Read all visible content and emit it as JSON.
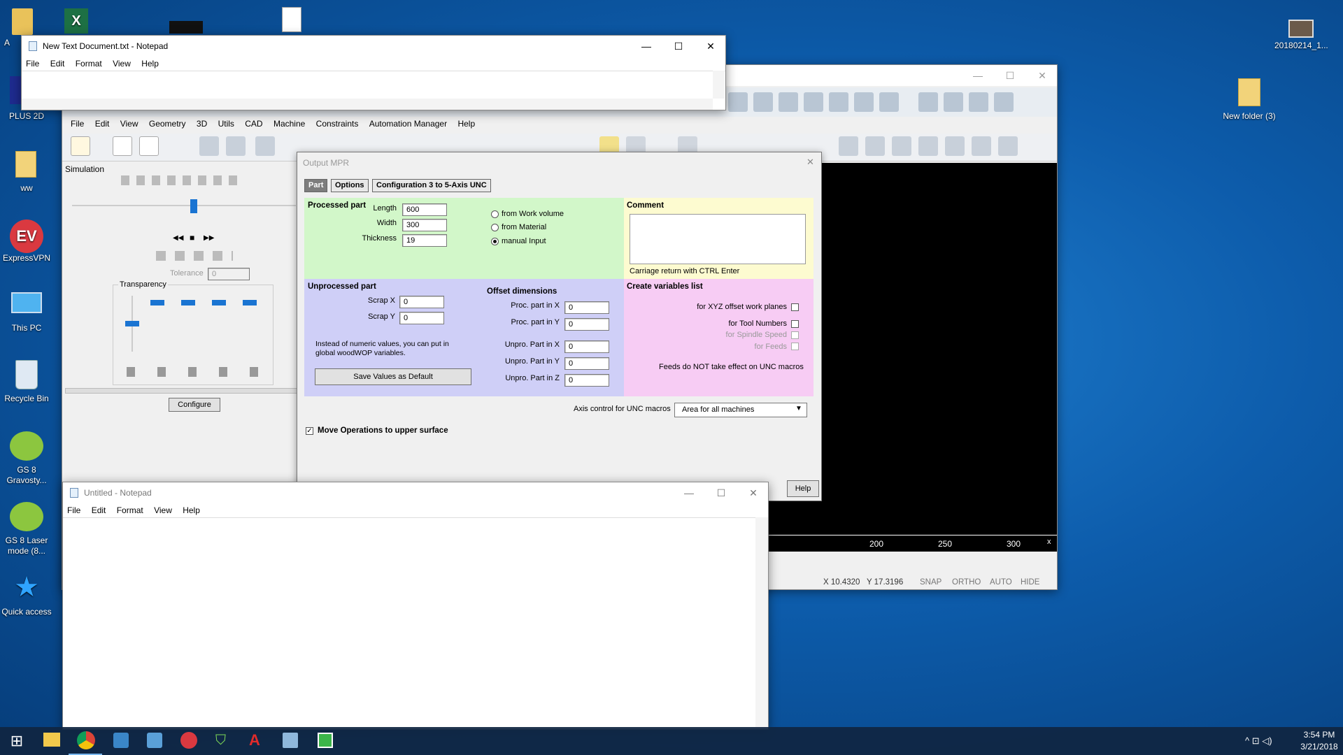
{
  "desktop": {
    "icons": [
      {
        "label": "A"
      },
      {
        "label": "PLUS 2D"
      },
      {
        "label": "ww"
      },
      {
        "label": "ExpressVPN"
      },
      {
        "label": "This PC"
      },
      {
        "label": "Recycle Bin"
      },
      {
        "label": "GS 8 Gravosty..."
      },
      {
        "label": "GS 8 Laser mode (8..."
      },
      {
        "label": "Quick access"
      },
      {
        "label": "20180214_1..."
      },
      {
        "label": "New folder (3)"
      }
    ]
  },
  "notepad_top": {
    "title": "New Text Document.txt - Notepad",
    "menu": [
      "File",
      "Edit",
      "Format",
      "View",
      "Help"
    ],
    "min": "—",
    "max": "☐",
    "close": "✕"
  },
  "cad": {
    "menu": [
      "File",
      "Edit",
      "View",
      "Geometry",
      "3D",
      "Utils",
      "CAD",
      "Machine",
      "Constraints",
      "Automation Manager",
      "Help"
    ],
    "min": "—",
    "max": "☐",
    "close": "✕",
    "simulation": {
      "title": "Simulation",
      "tolerance_label": "Tolerance",
      "tolerance_value": "0",
      "transparency": "Transparency",
      "configure": "Configure"
    },
    "ruler": [
      "200",
      "250",
      "300"
    ],
    "ruler_x": "x",
    "status": [
      "X 10.4320",
      "Y 17.3196",
      "SNAP",
      "ORTHO",
      "AUTO",
      "HIDE"
    ]
  },
  "dialog": {
    "title": "Output MPR",
    "close": "✕",
    "tabs": [
      "Part",
      "Options",
      "Configuration 3 to 5-Axis UNC"
    ],
    "processed": {
      "title": "Processed part",
      "length_label": "Length",
      "length": "600",
      "width_label": "Width",
      "width": "300",
      "thickness_label": "Thickness",
      "thickness": "19"
    },
    "source": [
      "from Work volume",
      "from Material",
      "manual Input"
    ],
    "comment": {
      "title": "Comment",
      "hint": "Carriage return with CTRL Enter"
    },
    "unprocessed": {
      "title": "Unprocessed part",
      "scrapx_label": "Scrap X",
      "scrapx": "0",
      "scrapy_label": "Scrap Y",
      "scrapy": "0",
      "info": "Instead of numeric values, you can put in global woodWOP variables.",
      "save": "Save Values as Default"
    },
    "offset": {
      "title": "Offset dimensions",
      "rows": [
        {
          "label": "Proc. part in X",
          "value": "0"
        },
        {
          "label": "Proc. part in Y",
          "value": "0"
        },
        {
          "label": "Unpro. Part in X",
          "value": "0"
        },
        {
          "label": "Unpro. Part in Y",
          "value": "0"
        },
        {
          "label": "Unpro. Part in Z",
          "value": "0"
        }
      ]
    },
    "vars": {
      "title": "Create variables list",
      "items": [
        "for XYZ offset work planes",
        "for Tool Numbers",
        "for Spindle Speed",
        "for Feeds"
      ],
      "note": "Feeds do NOT take effect on UNC macros"
    },
    "axis": {
      "label": "Axis control for UNC macros",
      "value": "Area for all machines"
    },
    "move_ops": "Move Operations to upper surface",
    "help": "Help"
  },
  "notepad_bottom": {
    "title": "Untitled - Notepad",
    "menu": [
      "File",
      "Edit",
      "Format",
      "View",
      "Help"
    ],
    "min": "—",
    "max": "☐",
    "close": "✕"
  },
  "taskbar": {
    "time": "3:54 PM",
    "date": "3/21/2018",
    "tray": "^ ⊡ ◁)"
  },
  "colors": {
    "processed": "#d2f7c9",
    "comment": "#fdfbd0",
    "unprocessed": "#cfcff7",
    "vars": "#f7ccf4"
  }
}
